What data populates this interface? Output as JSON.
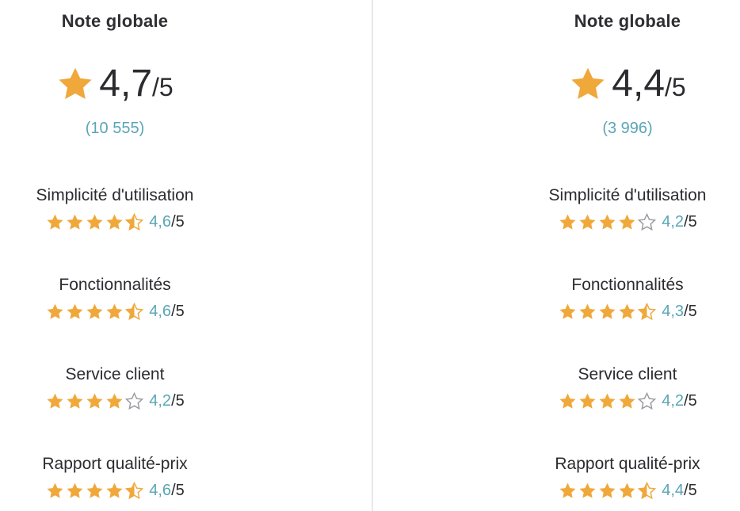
{
  "colors": {
    "star": "#f0a83a",
    "accent": "#5aa5b5",
    "text": "#2b2b30",
    "divider": "#e8e8ec"
  },
  "columns": [
    {
      "title": "Note globale",
      "score": "4,7",
      "max": "/5",
      "count": "(10 555)",
      "criteria": [
        {
          "label": "Simplicité d'utilisation",
          "score": "4,6",
          "max": "/5",
          "stars": 4.5
        },
        {
          "label": "Fonctionnalités",
          "score": "4,6",
          "max": "/5",
          "stars": 4.5
        },
        {
          "label": "Service client",
          "score": "4,2",
          "max": "/5",
          "stars": 4
        },
        {
          "label": "Rapport qualité-prix",
          "score": "4,6",
          "max": "/5",
          "stars": 4.5
        }
      ]
    },
    {
      "title": "Note globale",
      "score": "4,4",
      "max": "/5",
      "count": "(3 996)",
      "criteria": [
        {
          "label": "Simplicité d'utilisation",
          "score": "4,2",
          "max": "/5",
          "stars": 4
        },
        {
          "label": "Fonctionnalités",
          "score": "4,3",
          "max": "/5",
          "stars": 4.5
        },
        {
          "label": "Service client",
          "score": "4,2",
          "max": "/5",
          "stars": 4
        },
        {
          "label": "Rapport qualité-prix",
          "score": "4,4",
          "max": "/5",
          "stars": 4.5
        }
      ]
    }
  ]
}
